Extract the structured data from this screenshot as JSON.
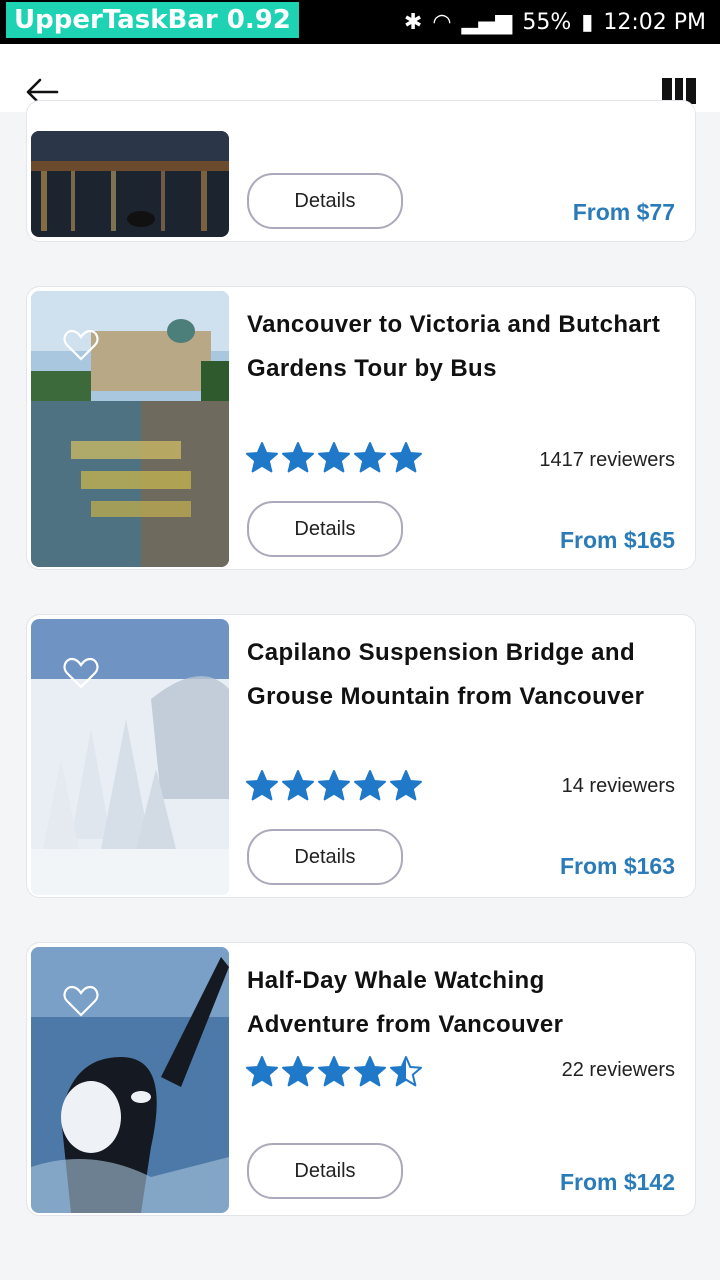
{
  "status_bar": {
    "label": "UpperTaskBar 0.92",
    "battery": "55%",
    "time": "12:02 PM"
  },
  "nav": {
    "back_icon": "arrow-left-icon",
    "menu_icon": "menu-bars-icon"
  },
  "cards": [
    {
      "details_label": "Details",
      "price": "From $77"
    },
    {
      "title": "Vancouver to Victoria and Butchart Gardens Tour by Bus",
      "rating": 5,
      "reviewers": "1417 reviewers",
      "details_label": "Details",
      "price": "From $165"
    },
    {
      "title": "Capilano Suspension Bridge and Grouse Mountain from Vancouver",
      "rating": 5,
      "reviewers": "14 reviewers",
      "details_label": "Details",
      "price": "From $163"
    },
    {
      "title": "Half-Day Whale Watching Adventure from Vancouver",
      "rating": 4.5,
      "reviewers": "22 reviewers",
      "details_label": "Details",
      "price": "From $142"
    }
  ],
  "colors": {
    "star": "#1f78c8",
    "price": "#2a7bb8",
    "accent": "#1ed2b4"
  }
}
